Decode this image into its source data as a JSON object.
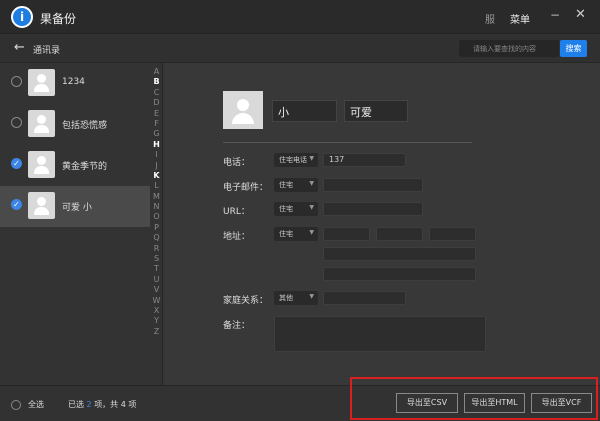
{
  "app": {
    "title": "果备份",
    "menu_partial": "服",
    "menu": "菜单",
    "minimize": "−",
    "close": "✕",
    "logo_letter": "i"
  },
  "toolbar": {
    "back": "←",
    "breadcrumb": "通讯录",
    "search_placeholder": "请输入要查找的内容",
    "search_button": "搜索"
  },
  "contacts": [
    {
      "name": "1234",
      "checked": false
    },
    {
      "name": "包括恐慌感",
      "checked": false
    },
    {
      "name": "黄金季节的",
      "checked": true
    },
    {
      "name": "可爱 小",
      "checked": true,
      "selected": true
    }
  ],
  "alphabet": [
    "A",
    "B",
    "C",
    "D",
    "E",
    "F",
    "G",
    "H",
    "I",
    "J",
    "K",
    "L",
    "M",
    "N",
    "O",
    "P",
    "Q",
    "R",
    "S",
    "T",
    "U",
    "V",
    "W",
    "X",
    "Y",
    "Z"
  ],
  "alphabet_bold": [
    "B",
    "H",
    "K"
  ],
  "detail": {
    "last_name": "小",
    "first_name": "可爱",
    "phone_label": "电话：",
    "phone_type": "住宅电话",
    "phone_value": "137",
    "email_label": "电子邮件：",
    "email_type": "住宅",
    "url_label": "URL：",
    "url_type": "住宅",
    "address_label": "地址：",
    "address_type": "住宅",
    "family_label": "家庭关系：",
    "family_type": "其他",
    "notes_label": "备注："
  },
  "footer": {
    "select_all": "全选",
    "status_prefix": "已选",
    "selected_count": "2",
    "status_suffix": "项，共 4 项",
    "export_csv": "导出至CSV",
    "export_html": "导出至HTML",
    "export_vcf": "导出至VCF"
  },
  "colors": {
    "accent": "#1f80ec",
    "highlight_box": "#d82020"
  }
}
